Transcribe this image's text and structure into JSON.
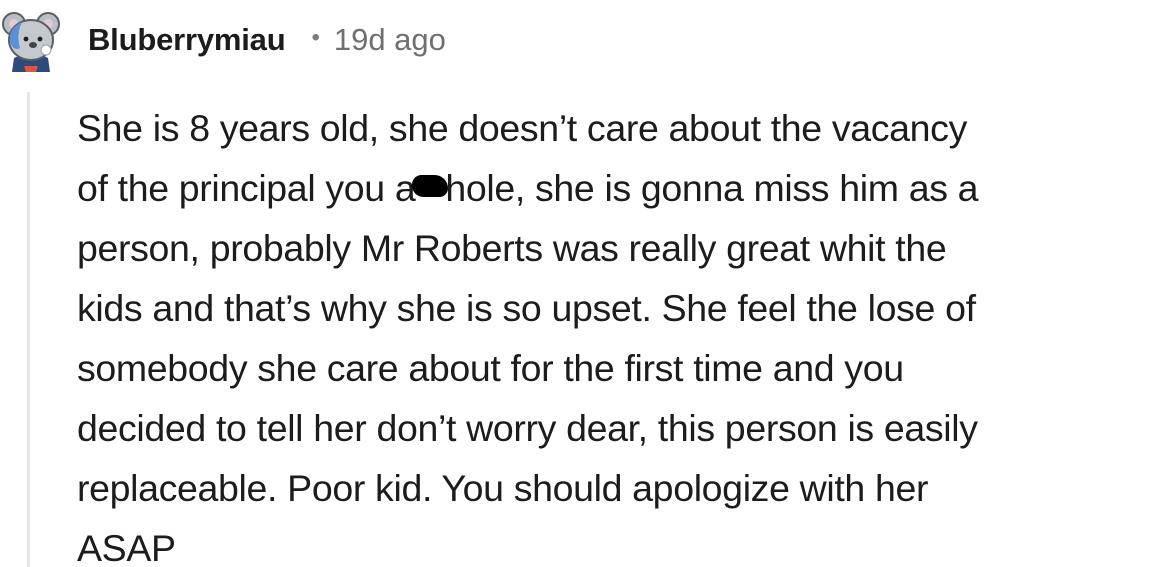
{
  "comment": {
    "username": "Bluberrymiau",
    "separator": "•",
    "timestamp": "19d ago",
    "body_lines": [
      "She is 8 years old, she doesn’t care about the vacancy",
      "of the principal you a",
      "hole, she is gonna miss him as a",
      "person, probably Mr Roberts was really great whit the",
      "kids and that’s why she is so upset. She feel the lose of",
      "somebody she care about for the first time and you",
      "decided to tell her don’t worry dear, this person is easily",
      "replaceable. Poor kid. You should apologize with her",
      "ASAP"
    ]
  },
  "colors": {
    "text": "#1c1c1c",
    "meta": "#6f6f6f",
    "thread_line": "#e6e6e6"
  },
  "icons": {
    "avatar": "koala-avatar-icon",
    "censor": "censor-scribble"
  }
}
